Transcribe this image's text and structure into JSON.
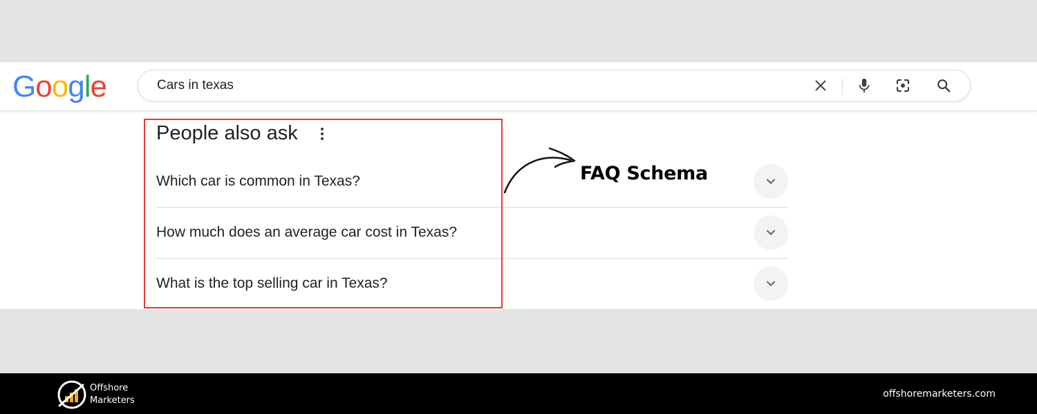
{
  "logo": {
    "letters": [
      "G",
      "o",
      "o",
      "g",
      "l",
      "e"
    ],
    "colors": [
      "#4285F4",
      "#EA4335",
      "#FBBC05",
      "#4285F4",
      "#34A853",
      "#EA4335"
    ]
  },
  "search": {
    "query": "Cars in texas"
  },
  "icons": {
    "clear": "close-icon",
    "voice": "microphone-icon",
    "lens": "camera-lens-icon",
    "search": "search-icon"
  },
  "paa": {
    "title": "People also ask",
    "questions": [
      "Which car is common in Texas?",
      "How much does an average car cost in Texas?",
      "What is the top selling car in Texas?"
    ]
  },
  "annotation": {
    "label": "FAQ Schema",
    "box_color": "#e53935"
  },
  "footer": {
    "brand_line1": "Offshore",
    "brand_line2": "Marketers",
    "website": "offshoremarketers.com"
  }
}
